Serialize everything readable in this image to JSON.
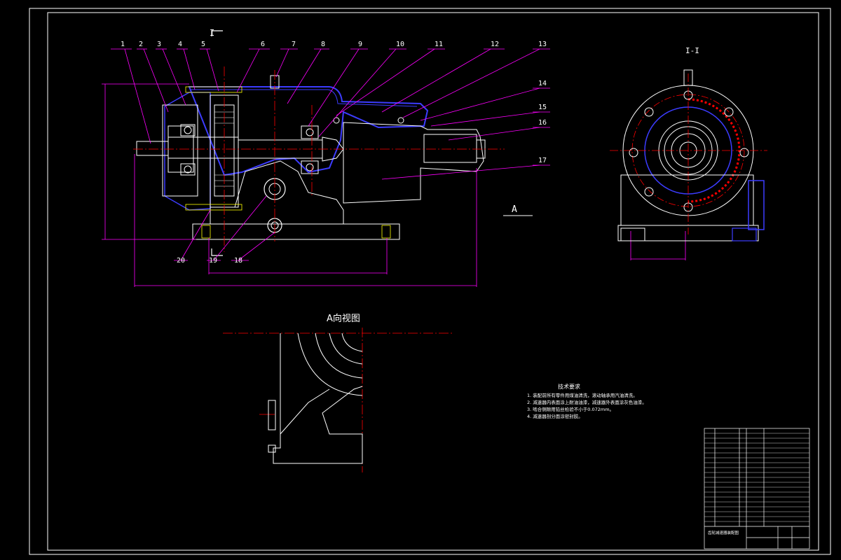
{
  "drawing": {
    "section_mark": "I",
    "side_view_label": "I-I",
    "view_marker": "A",
    "view_a_title": "A向视图",
    "balloons": [
      "1",
      "2",
      "3",
      "4",
      "5",
      "6",
      "7",
      "8",
      "9",
      "10",
      "11",
      "12",
      "13",
      "14",
      "15",
      "16",
      "17",
      "18",
      "19",
      "20"
    ],
    "tech_notes_title": "技术要求",
    "tech_notes": [
      "1. 装配前所有零件用煤油清洗，滚动轴承用汽油清洗。",
      "2. 减速器内表面涂上耐油油漆，减速器外表面涂灰色油漆。",
      "3. 啮合侧隙用铅丝检验不小于0.072mm。",
      "4. 减速器剖分面涂密封胶。"
    ],
    "title_block_name": "齿轮减速器装配图"
  },
  "colors": {
    "background": "#000000",
    "line": "#ffffff",
    "leader": "#ff00ff",
    "section": "#3c3cff",
    "center": "#ff0000",
    "hidden": "#ffff00"
  }
}
